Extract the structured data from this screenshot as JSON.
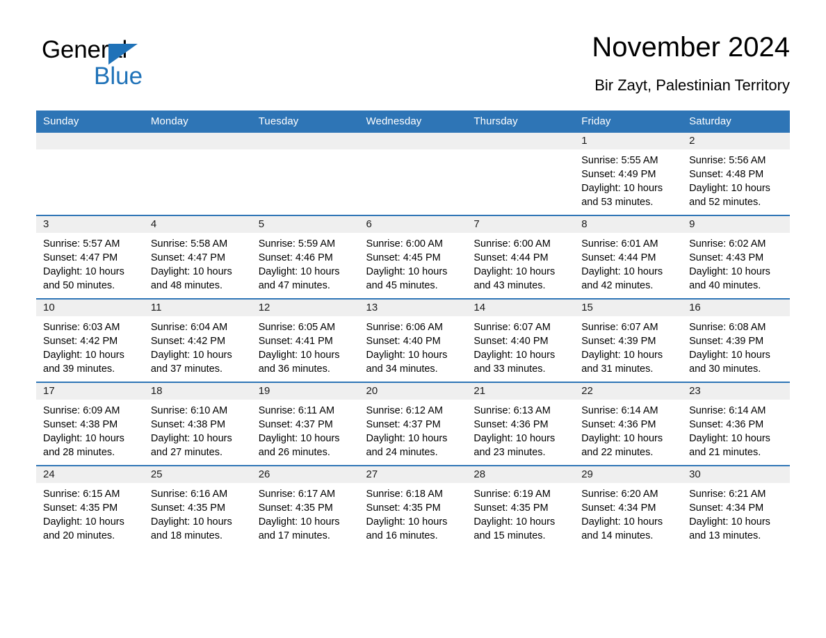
{
  "logo": {
    "word_top": "General",
    "word_bottom": "Blue",
    "triangle_icon": "blue-triangle-icon",
    "accent_color": "#1F72B8"
  },
  "header": {
    "title": "November 2024",
    "subtitle": "Bir Zayt, Palestinian Territory"
  },
  "theme": {
    "header_blue": "#2E75B6",
    "daynum_band": "#EFEFEF",
    "text": "#000000"
  },
  "labels": {
    "sunrise_prefix": "Sunrise:",
    "sunset_prefix": "Sunset:",
    "daylight_prefix": "Daylight:"
  },
  "weekdays": [
    "Sunday",
    "Monday",
    "Tuesday",
    "Wednesday",
    "Thursday",
    "Friday",
    "Saturday"
  ],
  "weeks": [
    [
      {
        "day": "",
        "sunrise": "",
        "sunset": "",
        "daylight_line1": "",
        "daylight_line2": ""
      },
      {
        "day": "",
        "sunrise": "",
        "sunset": "",
        "daylight_line1": "",
        "daylight_line2": ""
      },
      {
        "day": "",
        "sunrise": "",
        "sunset": "",
        "daylight_line1": "",
        "daylight_line2": ""
      },
      {
        "day": "",
        "sunrise": "",
        "sunset": "",
        "daylight_line1": "",
        "daylight_line2": ""
      },
      {
        "day": "",
        "sunrise": "",
        "sunset": "",
        "daylight_line1": "",
        "daylight_line2": ""
      },
      {
        "day": "1",
        "sunrise": "Sunrise: 5:55 AM",
        "sunset": "Sunset: 4:49 PM",
        "daylight_line1": "Daylight: 10 hours",
        "daylight_line2": "and 53 minutes."
      },
      {
        "day": "2",
        "sunrise": "Sunrise: 5:56 AM",
        "sunset": "Sunset: 4:48 PM",
        "daylight_line1": "Daylight: 10 hours",
        "daylight_line2": "and 52 minutes."
      }
    ],
    [
      {
        "day": "3",
        "sunrise": "Sunrise: 5:57 AM",
        "sunset": "Sunset: 4:47 PM",
        "daylight_line1": "Daylight: 10 hours",
        "daylight_line2": "and 50 minutes."
      },
      {
        "day": "4",
        "sunrise": "Sunrise: 5:58 AM",
        "sunset": "Sunset: 4:47 PM",
        "daylight_line1": "Daylight: 10 hours",
        "daylight_line2": "and 48 minutes."
      },
      {
        "day": "5",
        "sunrise": "Sunrise: 5:59 AM",
        "sunset": "Sunset: 4:46 PM",
        "daylight_line1": "Daylight: 10 hours",
        "daylight_line2": "and 47 minutes."
      },
      {
        "day": "6",
        "sunrise": "Sunrise: 6:00 AM",
        "sunset": "Sunset: 4:45 PM",
        "daylight_line1": "Daylight: 10 hours",
        "daylight_line2": "and 45 minutes."
      },
      {
        "day": "7",
        "sunrise": "Sunrise: 6:00 AM",
        "sunset": "Sunset: 4:44 PM",
        "daylight_line1": "Daylight: 10 hours",
        "daylight_line2": "and 43 minutes."
      },
      {
        "day": "8",
        "sunrise": "Sunrise: 6:01 AM",
        "sunset": "Sunset: 4:44 PM",
        "daylight_line1": "Daylight: 10 hours",
        "daylight_line2": "and 42 minutes."
      },
      {
        "day": "9",
        "sunrise": "Sunrise: 6:02 AM",
        "sunset": "Sunset: 4:43 PM",
        "daylight_line1": "Daylight: 10 hours",
        "daylight_line2": "and 40 minutes."
      }
    ],
    [
      {
        "day": "10",
        "sunrise": "Sunrise: 6:03 AM",
        "sunset": "Sunset: 4:42 PM",
        "daylight_line1": "Daylight: 10 hours",
        "daylight_line2": "and 39 minutes."
      },
      {
        "day": "11",
        "sunrise": "Sunrise: 6:04 AM",
        "sunset": "Sunset: 4:42 PM",
        "daylight_line1": "Daylight: 10 hours",
        "daylight_line2": "and 37 minutes."
      },
      {
        "day": "12",
        "sunrise": "Sunrise: 6:05 AM",
        "sunset": "Sunset: 4:41 PM",
        "daylight_line1": "Daylight: 10 hours",
        "daylight_line2": "and 36 minutes."
      },
      {
        "day": "13",
        "sunrise": "Sunrise: 6:06 AM",
        "sunset": "Sunset: 4:40 PM",
        "daylight_line1": "Daylight: 10 hours",
        "daylight_line2": "and 34 minutes."
      },
      {
        "day": "14",
        "sunrise": "Sunrise: 6:07 AM",
        "sunset": "Sunset: 4:40 PM",
        "daylight_line1": "Daylight: 10 hours",
        "daylight_line2": "and 33 minutes."
      },
      {
        "day": "15",
        "sunrise": "Sunrise: 6:07 AM",
        "sunset": "Sunset: 4:39 PM",
        "daylight_line1": "Daylight: 10 hours",
        "daylight_line2": "and 31 minutes."
      },
      {
        "day": "16",
        "sunrise": "Sunrise: 6:08 AM",
        "sunset": "Sunset: 4:39 PM",
        "daylight_line1": "Daylight: 10 hours",
        "daylight_line2": "and 30 minutes."
      }
    ],
    [
      {
        "day": "17",
        "sunrise": "Sunrise: 6:09 AM",
        "sunset": "Sunset: 4:38 PM",
        "daylight_line1": "Daylight: 10 hours",
        "daylight_line2": "and 28 minutes."
      },
      {
        "day": "18",
        "sunrise": "Sunrise: 6:10 AM",
        "sunset": "Sunset: 4:38 PM",
        "daylight_line1": "Daylight: 10 hours",
        "daylight_line2": "and 27 minutes."
      },
      {
        "day": "19",
        "sunrise": "Sunrise: 6:11 AM",
        "sunset": "Sunset: 4:37 PM",
        "daylight_line1": "Daylight: 10 hours",
        "daylight_line2": "and 26 minutes."
      },
      {
        "day": "20",
        "sunrise": "Sunrise: 6:12 AM",
        "sunset": "Sunset: 4:37 PM",
        "daylight_line1": "Daylight: 10 hours",
        "daylight_line2": "and 24 minutes."
      },
      {
        "day": "21",
        "sunrise": "Sunrise: 6:13 AM",
        "sunset": "Sunset: 4:36 PM",
        "daylight_line1": "Daylight: 10 hours",
        "daylight_line2": "and 23 minutes."
      },
      {
        "day": "22",
        "sunrise": "Sunrise: 6:14 AM",
        "sunset": "Sunset: 4:36 PM",
        "daylight_line1": "Daylight: 10 hours",
        "daylight_line2": "and 22 minutes."
      },
      {
        "day": "23",
        "sunrise": "Sunrise: 6:14 AM",
        "sunset": "Sunset: 4:36 PM",
        "daylight_line1": "Daylight: 10 hours",
        "daylight_line2": "and 21 minutes."
      }
    ],
    [
      {
        "day": "24",
        "sunrise": "Sunrise: 6:15 AM",
        "sunset": "Sunset: 4:35 PM",
        "daylight_line1": "Daylight: 10 hours",
        "daylight_line2": "and 20 minutes."
      },
      {
        "day": "25",
        "sunrise": "Sunrise: 6:16 AM",
        "sunset": "Sunset: 4:35 PM",
        "daylight_line1": "Daylight: 10 hours",
        "daylight_line2": "and 18 minutes."
      },
      {
        "day": "26",
        "sunrise": "Sunrise: 6:17 AM",
        "sunset": "Sunset: 4:35 PM",
        "daylight_line1": "Daylight: 10 hours",
        "daylight_line2": "and 17 minutes."
      },
      {
        "day": "27",
        "sunrise": "Sunrise: 6:18 AM",
        "sunset": "Sunset: 4:35 PM",
        "daylight_line1": "Daylight: 10 hours",
        "daylight_line2": "and 16 minutes."
      },
      {
        "day": "28",
        "sunrise": "Sunrise: 6:19 AM",
        "sunset": "Sunset: 4:35 PM",
        "daylight_line1": "Daylight: 10 hours",
        "daylight_line2": "and 15 minutes."
      },
      {
        "day": "29",
        "sunrise": "Sunrise: 6:20 AM",
        "sunset": "Sunset: 4:34 PM",
        "daylight_line1": "Daylight: 10 hours",
        "daylight_line2": "and 14 minutes."
      },
      {
        "day": "30",
        "sunrise": "Sunrise: 6:21 AM",
        "sunset": "Sunset: 4:34 PM",
        "daylight_line1": "Daylight: 10 hours",
        "daylight_line2": "and 13 minutes."
      }
    ]
  ]
}
